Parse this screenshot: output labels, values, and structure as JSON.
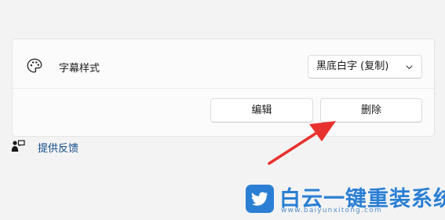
{
  "subtitle_setting": {
    "label": "字幕样式",
    "dropdown_value": "黑底白字 (复制)",
    "edit_button": "编辑",
    "delete_button": "删除",
    "icons": {
      "setting": "palette-icon",
      "dropdown": "chevron-down-icon"
    }
  },
  "footer": {
    "feedback_link": "提供反馈",
    "icon": "feedback-icon",
    "link_color": "#0f4a8a"
  },
  "annotation": {
    "arrow_color": "#e8322f",
    "icon": "arrow-icon"
  },
  "watermark": {
    "brand_text": "白云一键重装系统",
    "url": "www.baiyunxitong.com",
    "color": "#2a7fd4",
    "icon": "twitter-bird-logo"
  }
}
